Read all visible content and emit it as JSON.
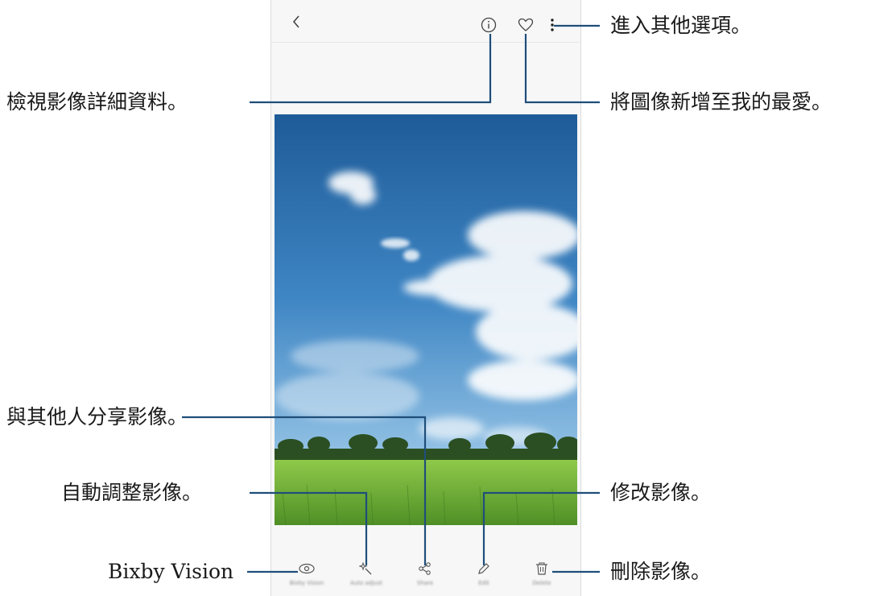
{
  "callouts": {
    "more_options": "進入其他選項。",
    "details": "檢視影像詳細資料。",
    "favorite": "將圖像新增至我的最愛。",
    "share": "與其他人分享影像。",
    "auto_adjust": "自動調整影像。",
    "edit": "修改影像。",
    "bixby": "Bixby Vision",
    "delete": "刪除影像。"
  },
  "topbar": {
    "icons": [
      "back-icon",
      "info-icon",
      "heart-icon",
      "more-vertical-icon"
    ]
  },
  "bottombar": {
    "items": [
      {
        "icon": "bixby-vision-icon",
        "label": "Bixby Vision"
      },
      {
        "icon": "auto-adjust-icon",
        "label": "Auto adjust"
      },
      {
        "icon": "share-icon",
        "label": "Share"
      },
      {
        "icon": "edit-icon",
        "label": "Edit"
      },
      {
        "icon": "delete-icon",
        "label": "Delete"
      }
    ]
  },
  "colors": {
    "sky_top": "#1f5f9f",
    "sky_bottom": "#8fc0e3",
    "grass": "#6fb23a",
    "callout_line": "#1f4e7a"
  }
}
